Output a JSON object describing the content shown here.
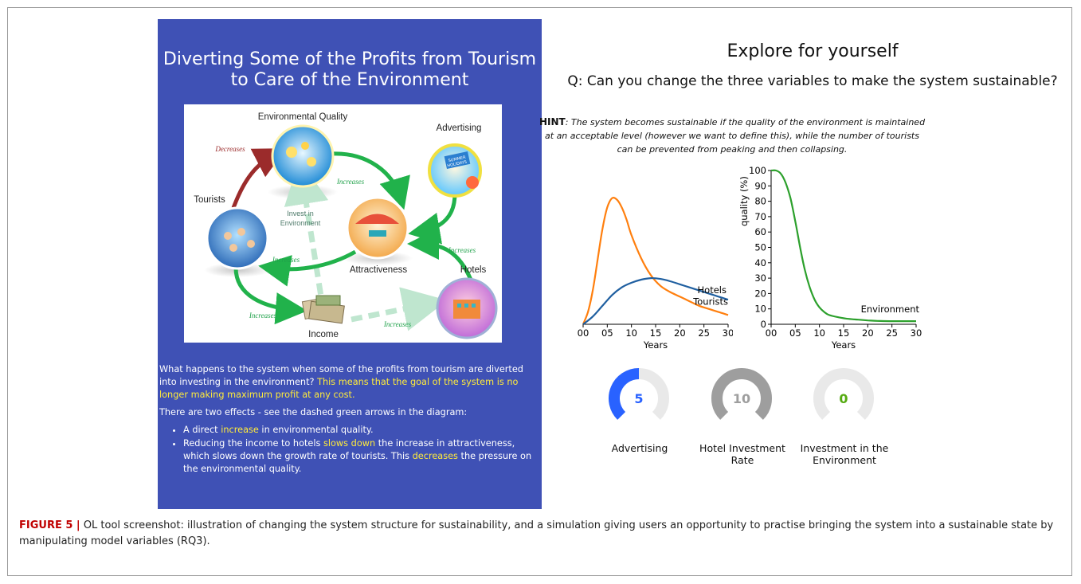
{
  "left_panel": {
    "title": "Diverting Some of the Profits from Tourism to Care of the Environment",
    "diagram": {
      "labels": {
        "environmental_quality": "Environmental Quality",
        "advertising": "Advertising",
        "tourists": "Tourists",
        "attractiveness": "Attractiveness",
        "hotels": "Hotels",
        "income": "Income",
        "invest_line1": "Invest in",
        "invest_line2": "Environment"
      },
      "arrow_labels": {
        "decreases": "Decreases",
        "increases_top": "Increases",
        "increases_left": "Increases",
        "increases_right": "Increases",
        "increases_bottom_left": "Increases",
        "increases_bottom": "Increases"
      },
      "sign_text": {
        "summer": "SUMMER",
        "holidays": "HOLIDAYS"
      }
    },
    "para1_normal": "What happens to the system when some of the profits from tourism are diverted into investing in the environment? ",
    "para1_highlight": "This means that the goal of the system is no longer making maximum profit at any cost.",
    "para2": "There are two effects - see the dashed green arrows in the diagram:",
    "bullet1_a": "A direct ",
    "bullet1_hl": "increase",
    "bullet1_b": " in environmental quality.",
    "bullet2_a": "Reducing the income to hotels ",
    "bullet2_hl1": "slows down",
    "bullet2_b": " the increase in attractiveness, which slows down the growth rate of tourists. This ",
    "bullet2_hl2": "decreases",
    "bullet2_c": " the pressure on the environmental quality."
  },
  "right_panel": {
    "title": "Explore for yourself",
    "question": "Q: Can you change the three variables to make the system sustainable?",
    "hint_label": "HINT",
    "hint_text": ": The system becomes sustainable if the quality of the environment is maintained at an acceptable level (however we want to define this), while the number of tourists can be prevented from peaking and then collapsing."
  },
  "chart_data": [
    {
      "type": "line",
      "x_tick_labels": [
        "00",
        "05",
        "10",
        "15",
        "20",
        "25",
        "30"
      ],
      "xlim": [
        0,
        30
      ],
      "xlabel": "Years",
      "ylim": [
        0,
        100
      ],
      "series": [
        {
          "name": "Tourists",
          "color": "#ff7f0e",
          "x": [
            0,
            1,
            2,
            3,
            4,
            5,
            6,
            7,
            8,
            9,
            10,
            12,
            14,
            16,
            18,
            20,
            22,
            24,
            26,
            28,
            30
          ],
          "y": [
            0,
            8,
            22,
            42,
            62,
            76,
            82,
            81,
            76,
            68,
            58,
            43,
            32,
            25,
            21,
            18,
            15,
            12,
            10,
            8,
            6
          ]
        },
        {
          "name": "Hotels",
          "color": "#1f5fa0",
          "x": [
            0,
            2,
            4,
            6,
            8,
            10,
            12,
            14,
            16,
            18,
            20,
            22,
            24,
            26,
            28,
            30
          ],
          "y": [
            0,
            5,
            12,
            19,
            24,
            27,
            29,
            30,
            29.5,
            28,
            26,
            24,
            22,
            20,
            18,
            16
          ]
        }
      ]
    },
    {
      "type": "line",
      "x_tick_labels": [
        "00",
        "05",
        "10",
        "15",
        "20",
        "25",
        "30"
      ],
      "xlim": [
        0,
        30
      ],
      "xlabel": "Years",
      "ylabel": "quality (%)",
      "ylim": [
        0,
        100
      ],
      "y_ticks": [
        0,
        10,
        20,
        30,
        40,
        50,
        60,
        70,
        80,
        90,
        100
      ],
      "series": [
        {
          "name": "Environment",
          "color": "#2ca02c",
          "x": [
            0,
            1,
            2,
            3,
            4,
            5,
            6,
            7,
            8,
            9,
            10,
            11,
            12,
            14,
            16,
            18,
            20,
            22,
            25,
            30
          ],
          "y": [
            100,
            100,
            98,
            92,
            82,
            67,
            50,
            35,
            24,
            16,
            11,
            8,
            6,
            4.5,
            3.5,
            3,
            2.5,
            2.2,
            2,
            2
          ]
        }
      ]
    }
  ],
  "gauges": [
    {
      "label": "Advertising",
      "value": "5",
      "fraction": 0.5,
      "color": "#2962ff",
      "text_color": "#2962ff"
    },
    {
      "label": "Hotel Investment Rate",
      "value": "10",
      "fraction": 1.0,
      "color": "#9e9e9e",
      "text_color": "#9e9e9e"
    },
    {
      "label": "Investment in the Environment",
      "value": "0",
      "fraction": 0.0,
      "color": "#66bb22",
      "text_color": "#55aa11"
    }
  ],
  "caption": {
    "label": "FIGURE 5 |",
    "text": " OL tool screenshot: illustration of changing the system structure for sustainability, and a simulation giving users an opportunity to practise bringing the system into a sustainable state by manipulating model variables (RQ3)."
  }
}
